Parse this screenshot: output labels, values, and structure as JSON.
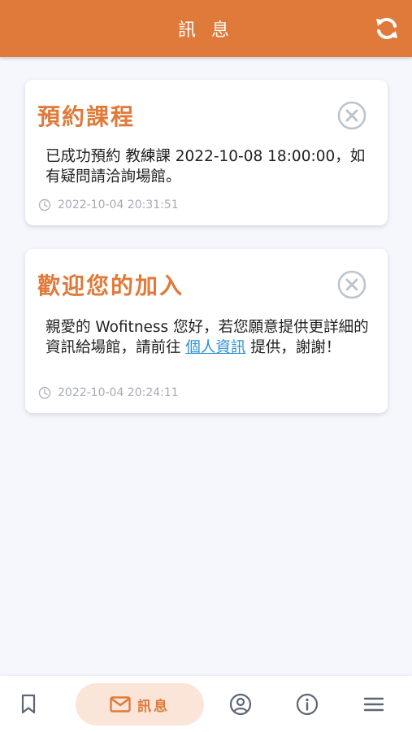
{
  "header": {
    "title": "訊 息",
    "refresh_icon": "refresh-icon"
  },
  "messages": [
    {
      "title": "預約課程",
      "body": "已成功預約 教練課 2022-10-08 18:00:00，如有疑問請洽詢場館。",
      "time": "2022-10-04 20:31:51"
    },
    {
      "title": "歡迎您的加入",
      "body_pre": "親愛的 Wofitness 您好，若您願意提供更詳細的資訊給場館，請前往 ",
      "body_link": "個人資訊",
      "body_post": " 提供，謝謝！",
      "time": "2022-10-04 20:24:11"
    }
  ],
  "bottom_nav": {
    "items": [
      {
        "icon": "bookmark-icon"
      },
      {
        "icon": "mail-icon",
        "label": "訊息",
        "active": true
      },
      {
        "icon": "user-circle-icon"
      },
      {
        "icon": "info-icon"
      },
      {
        "icon": "menu-icon"
      }
    ]
  },
  "colors": {
    "accent": "#e07a3a",
    "active_nav_bg": "#fbe5d8",
    "link": "#2a8fd6",
    "page_bg": "#f5f7fc"
  }
}
